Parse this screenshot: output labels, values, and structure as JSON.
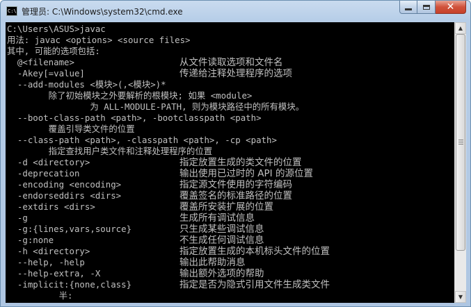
{
  "window": {
    "title": "管理员: C:\\Windows\\system32\\cmd.exe",
    "icon_text": "C:\\",
    "caption": {
      "minimize": "—",
      "maximize": "□",
      "close": "✕"
    }
  },
  "console": {
    "lines": [
      {
        "text": "C:\\Users\\ASUS>javac"
      },
      {
        "text": "用法: javac <options> <source files>"
      },
      {
        "text": "其中, 可能的选项包括:"
      },
      {
        "opt": "  @<filename>",
        "desc": "从文件读取选项和文件名"
      },
      {
        "opt": "  -Akey[=value]",
        "desc": "传递给注释处理程序的选项"
      },
      {
        "text": "  --add-modules <模块>(,<模块>)*"
      },
      {
        "text": "        除了初始模块之外要解析的根模块; 如果 <module>"
      },
      {
        "text": "                为 ALL-MODULE-PATH, 则为模块路径中的所有模块。"
      },
      {
        "text": "  --boot-class-path <path>, -bootclasspath <path>"
      },
      {
        "text": "        覆盖引导类文件的位置"
      },
      {
        "text": "  --class-path <path>, -classpath <path>, -cp <path>"
      },
      {
        "text": "        指定查找用户类文件和注释处理程序的位置"
      },
      {
        "opt": "  -d <directory>",
        "desc": "指定放置生成的类文件的位置"
      },
      {
        "opt": "  -deprecation",
        "desc": "输出使用已过时的 API 的源位置"
      },
      {
        "opt": "  -encoding <encoding>",
        "desc": "指定源文件使用的字符编码"
      },
      {
        "opt": "  -endorseddirs <dirs>",
        "desc": "覆盖签名的标准路径的位置"
      },
      {
        "opt": "  -extdirs <dirs>",
        "desc": "覆盖所安装扩展的位置"
      },
      {
        "opt": "  -g",
        "desc": "生成所有调试信息"
      },
      {
        "opt": "  -g:{lines,vars,source}",
        "desc": "只生成某些调试信息"
      },
      {
        "opt": "  -g:none",
        "desc": "不生成任何调试信息"
      },
      {
        "opt": "  -h <directory>",
        "desc": "指定放置生成的本机标头文件的位置"
      },
      {
        "opt": "  --help, -help",
        "desc": "输出此帮助消息"
      },
      {
        "opt": "  --help-extra, -X",
        "desc": "输出额外选项的帮助"
      },
      {
        "opt": "  -implicit:{none,class}",
        "desc": "指定是否为隐式引用文件生成类文件"
      },
      {
        "text": "          半:"
      }
    ]
  },
  "scrollbar": {
    "up_arrow": "▲",
    "down_arrow": "▼",
    "scroll_fraction": 0.0
  },
  "colors": {
    "console_bg": "#000000",
    "console_fg": "#c0c0c0"
  }
}
